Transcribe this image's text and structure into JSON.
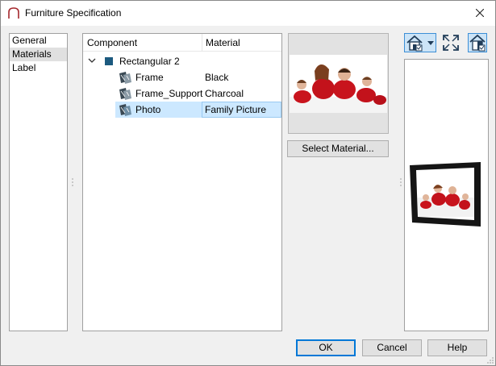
{
  "window": {
    "title": "Furniture Specification"
  },
  "nav": {
    "items": [
      {
        "label": "General",
        "selected": false
      },
      {
        "label": "Materials",
        "selected": true
      },
      {
        "label": "Label",
        "selected": false
      }
    ]
  },
  "tree": {
    "headers": {
      "component": "Component",
      "material": "Material"
    },
    "group": {
      "label": "Rectangular 2",
      "color": "#1c5a7f"
    },
    "rows": [
      {
        "component": "Frame",
        "material": "Black"
      },
      {
        "component": "Frame_Support",
        "material": "Charcoal"
      },
      {
        "component": "Photo",
        "material": "Family Picture"
      }
    ]
  },
  "buttons": {
    "select_material": "Select Material...",
    "ok": "OK",
    "cancel": "Cancel",
    "help": "Help"
  },
  "toolbar": {
    "icons": [
      "house-view-icon",
      "dropdown-arrow-icon",
      "fit-to-window-icon",
      "house-section-icon"
    ]
  },
  "colors": {
    "accent": "#0078d7",
    "selection": "#cce8ff"
  }
}
